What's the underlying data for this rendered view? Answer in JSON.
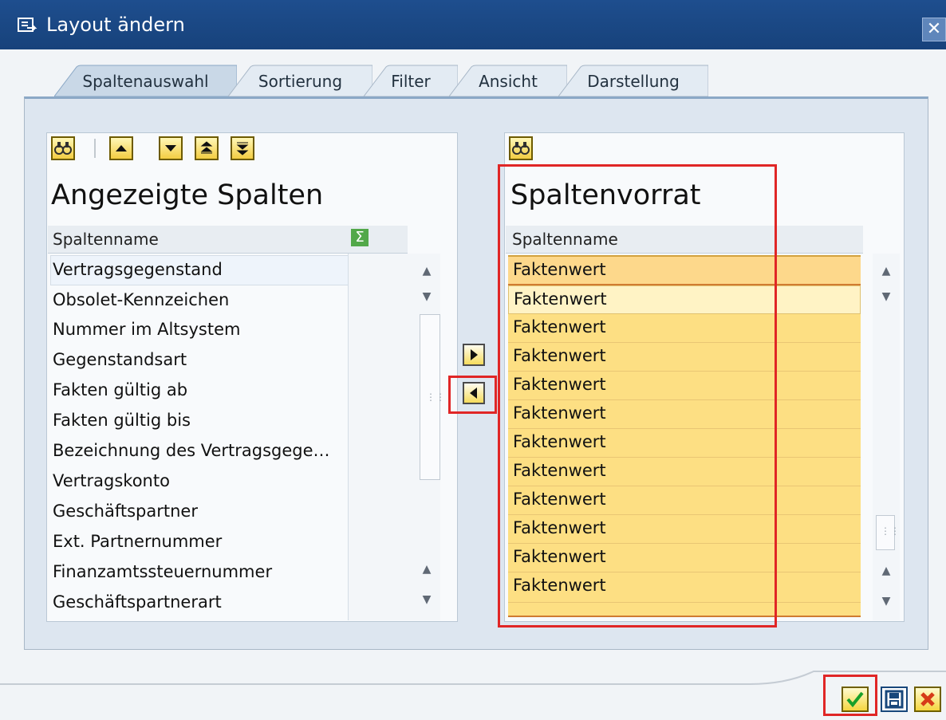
{
  "window": {
    "title": "Layout ändern",
    "close_label": "✕"
  },
  "tabs": [
    {
      "label": "Spaltenauswahl",
      "active": true
    },
    {
      "label": "Sortierung"
    },
    {
      "label": "Filter"
    },
    {
      "label": "Ansicht"
    },
    {
      "label": "Darstellung"
    }
  ],
  "left_panel": {
    "title": "Angezeigte Spalten",
    "column_header": "Spaltenname",
    "sum_icon_label": "Σ",
    "rows": [
      "Vertragsgegenstand",
      "Obsolet-Kennzeichen",
      "Nummer im Altsystem",
      "Gegenstandsart",
      "Fakten gültig ab",
      "Fakten gültig bis",
      "Bezeichnung des Vertragsgege…",
      "Vertragskonto",
      "Geschäftspartner",
      "Ext. Partnernummer",
      "Finanzamtssteuernummer",
      "Geschäftspartnerart"
    ]
  },
  "right_panel": {
    "title": "Spaltenvorrat",
    "column_header": "Spaltenname",
    "rows": [
      "Faktenwert",
      "Faktenwert",
      "Faktenwert",
      "Faktenwert",
      "Faktenwert",
      "Faktenwert",
      "Faktenwert",
      "Faktenwert",
      "Faktenwert",
      "Faktenwert",
      "Faktenwert",
      "Faktenwert"
    ]
  },
  "colors": {
    "title_bar": "#17427b",
    "highlight": "#e02626",
    "available_row": "#fddf83"
  }
}
